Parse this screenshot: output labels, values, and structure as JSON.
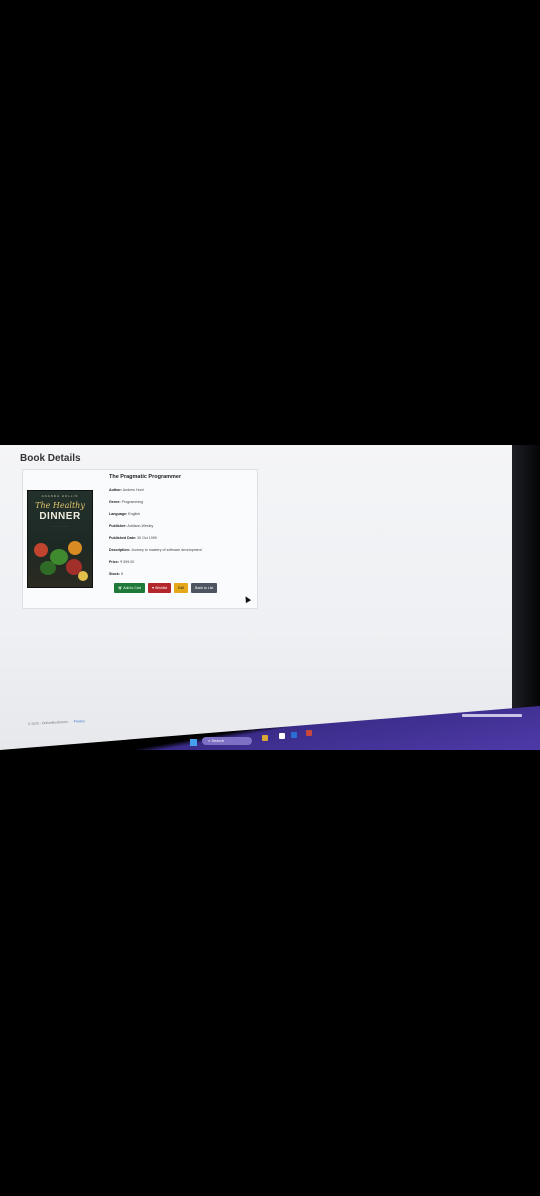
{
  "page": {
    "heading": "Book Details"
  },
  "book": {
    "cover": {
      "author_line": "ANANDA HOLLIS",
      "title_line_1": "The Healthy",
      "title_line_2": "DINNER"
    },
    "title": "The Pragmatic Programmer",
    "fields": [
      {
        "label": "Author:",
        "value": "Andrew Hunt"
      },
      {
        "label": "Genre:",
        "value": "Programming"
      },
      {
        "label": "Language:",
        "value": "English"
      },
      {
        "label": "Publisher:",
        "value": "Addison-Wesley"
      },
      {
        "label": "Published Date:",
        "value": "30 Oct 1999"
      },
      {
        "label": "Description:",
        "value": "Journey to mastery of software development"
      },
      {
        "label": "Price:",
        "value": "₹ 599.00"
      },
      {
        "label": "Stock:",
        "value": "5"
      }
    ],
    "actions": {
      "add_to_cart": "Add to Cart",
      "wishlist": "Wishlist",
      "edit": "Edit",
      "back": "Back to List"
    }
  },
  "footer": {
    "copyright": "© 2025 - OnlineBookStore -",
    "privacy": "Privacy"
  },
  "taskbar": {
    "search_label": "Search"
  },
  "colors": {
    "add_to_cart": "#1e7a39",
    "wishlist": "#b3262c",
    "edit": "#e4a818",
    "back": "#4d5660",
    "taskbar": "#4e3aa8"
  }
}
